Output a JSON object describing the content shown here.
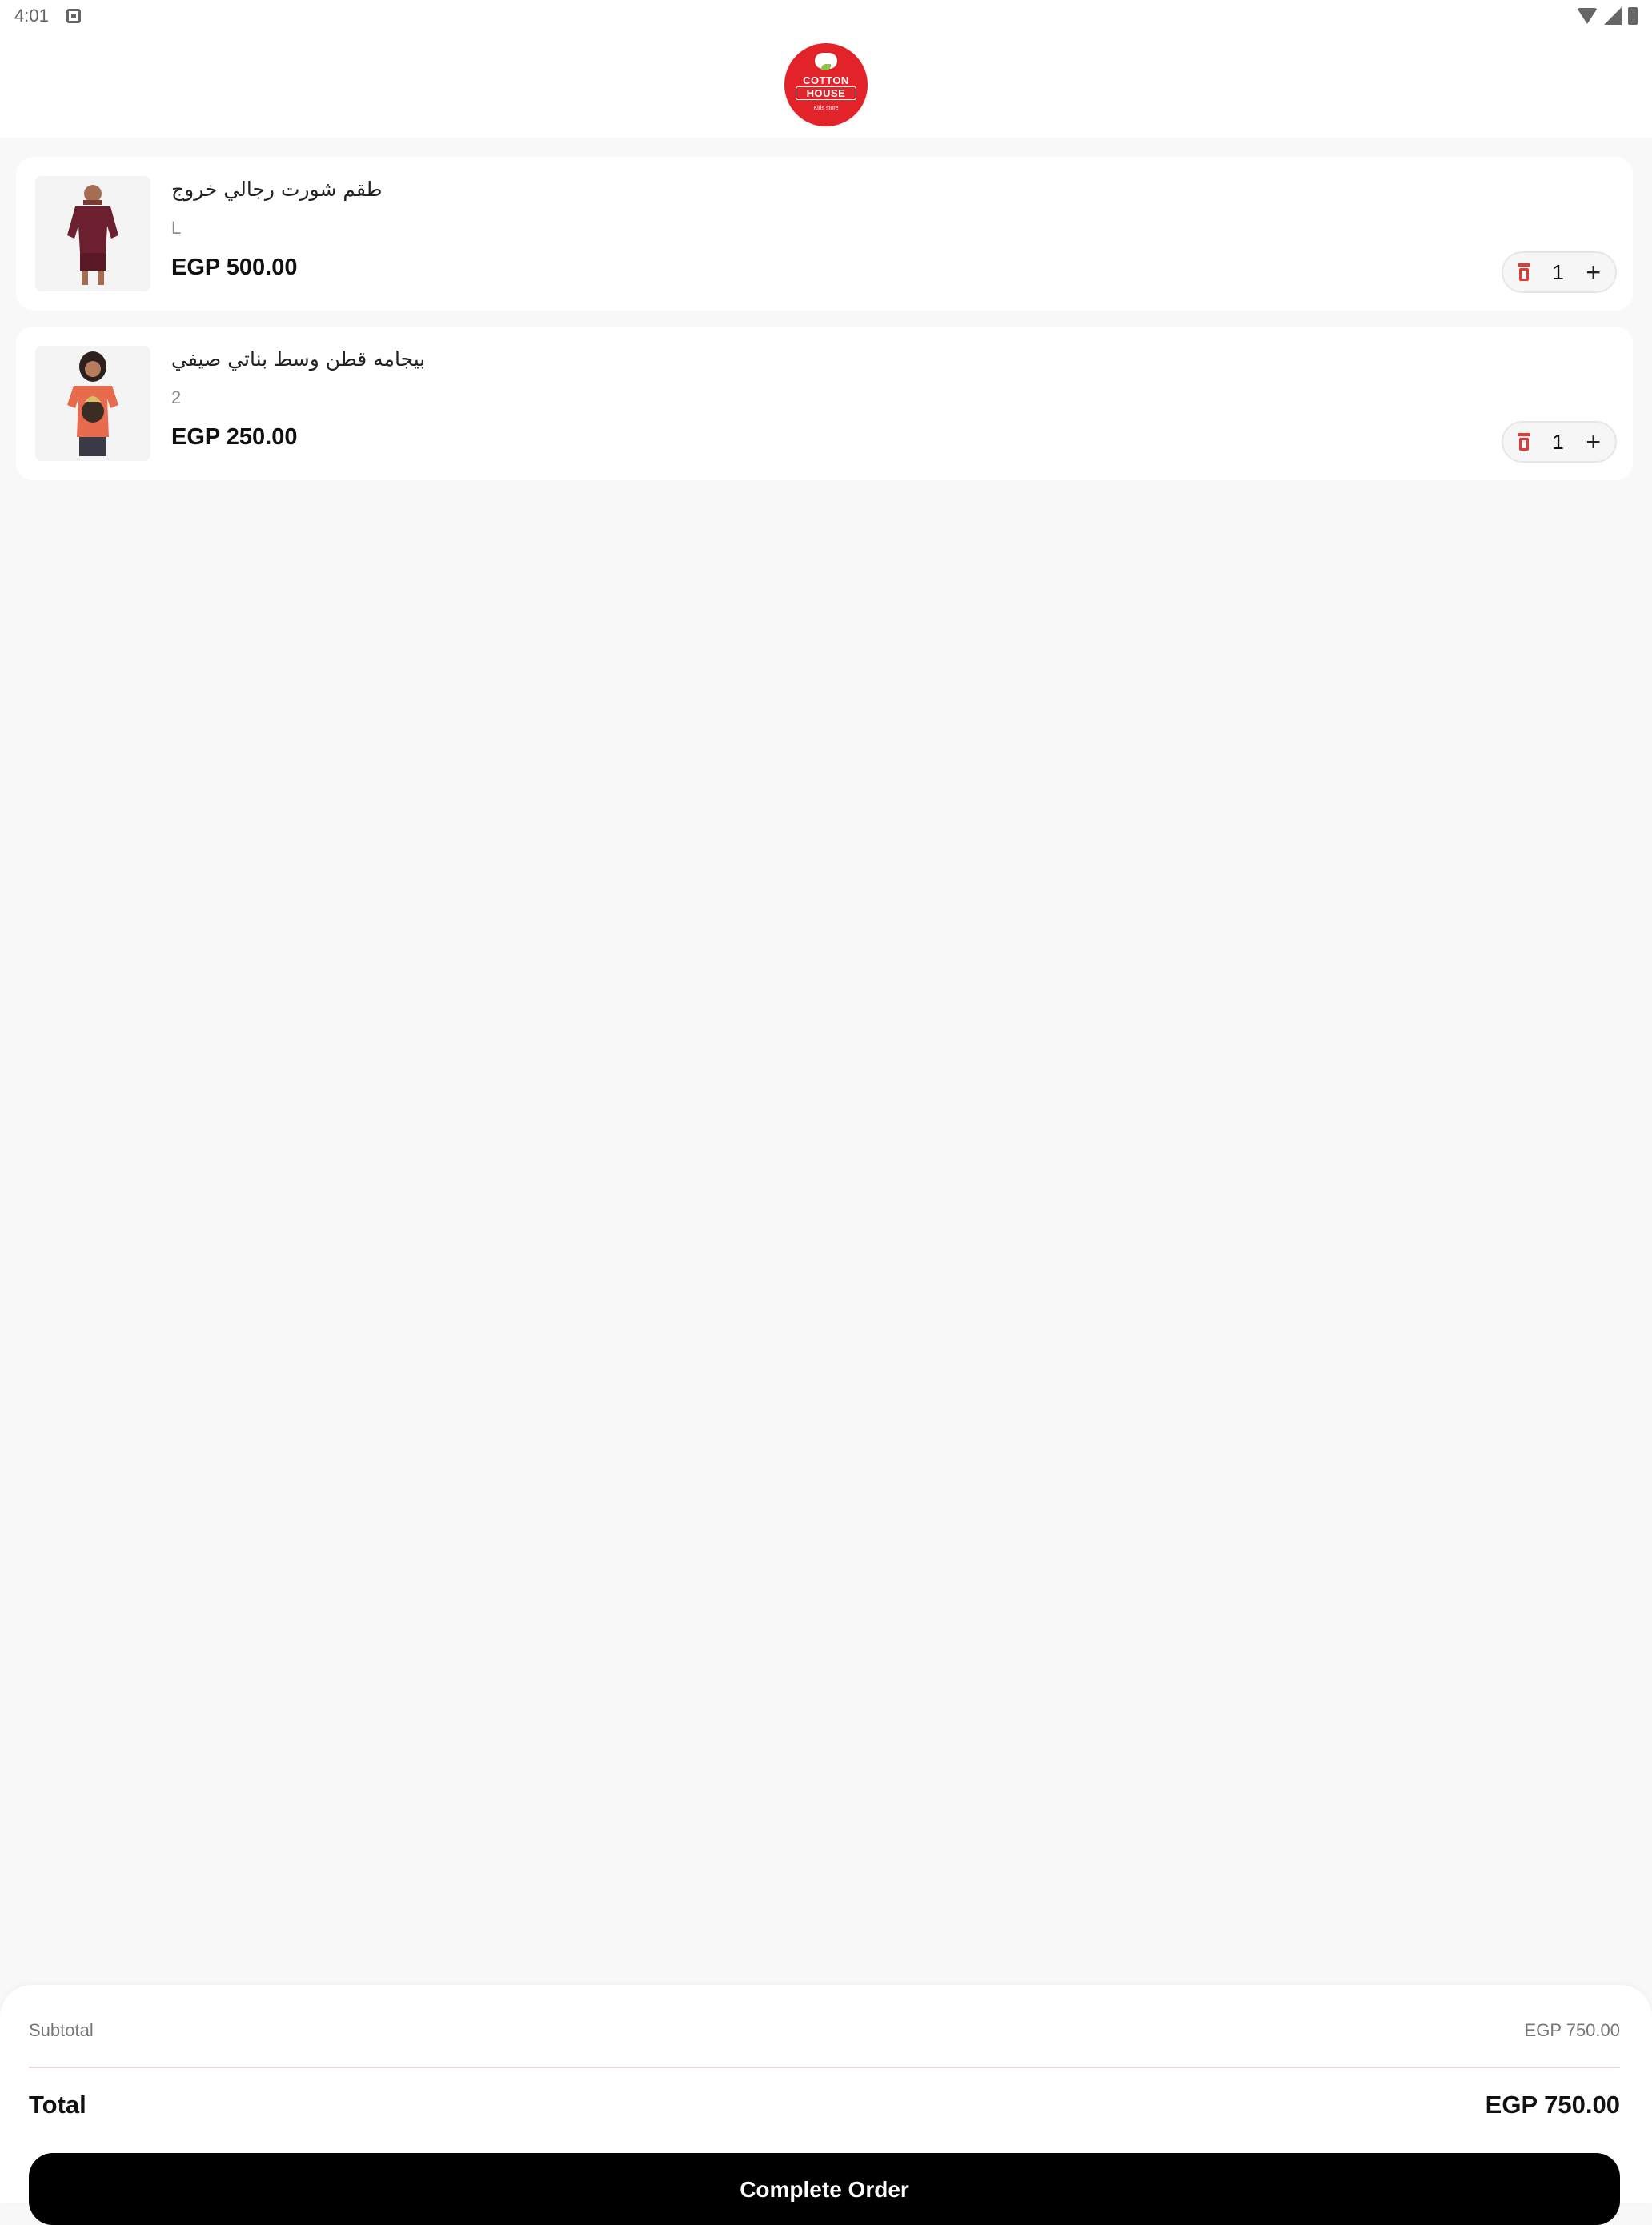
{
  "status_bar": {
    "time": "4:01"
  },
  "header": {
    "logo_alt": "Cotton House"
  },
  "cart": {
    "items": [
      {
        "name": "طقم شورت رجالي خروج",
        "variant": "L",
        "price": "EGP 500.00",
        "quantity": "1"
      },
      {
        "name": "بيجامه قطن وسط بناتي صيفي",
        "variant": "2",
        "price": "EGP 250.00",
        "quantity": "1"
      }
    ]
  },
  "summary": {
    "subtotal_label": "Subtotal",
    "subtotal_value": "EGP 750.00",
    "total_label": "Total",
    "total_value": "EGP 750.00",
    "complete_order_label": "Complete Order"
  },
  "colors": {
    "brand_red": "#e2232a",
    "delete_red": "#e53935",
    "button_black": "#000000",
    "background": "#f8f8f8"
  }
}
